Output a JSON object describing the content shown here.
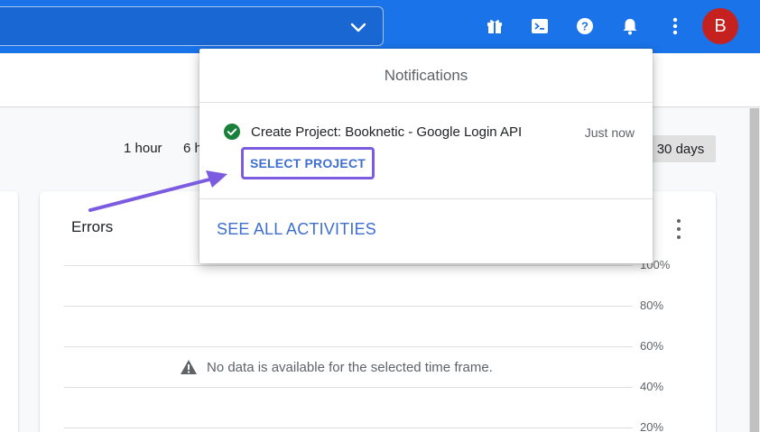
{
  "topbar": {
    "icons": [
      "gift-icon",
      "cloud-shell-icon",
      "help-icon",
      "notifications-icon",
      "more-vert-icon"
    ],
    "avatar_letter": "B",
    "accent": "#1a73e8"
  },
  "time_range": {
    "options": [
      "1 hour",
      "6 h"
    ],
    "selected": "30 days"
  },
  "card": {
    "title": "Errors",
    "empty_message": "No data is available for the selected time frame.",
    "y_ticks": [
      "100%",
      "80%",
      "60%",
      "40%",
      "20%"
    ]
  },
  "notifications": {
    "title": "Notifications",
    "item": {
      "text": "Create Project: Booknetic - Google Login API",
      "time": "Just now",
      "action": "SELECT PROJECT",
      "status": "success"
    },
    "see_all": "SEE ALL ACTIVITIES"
  },
  "colors": {
    "link": "#3e6fd0",
    "highlight": "#7b5ce0",
    "success": "#188038"
  }
}
